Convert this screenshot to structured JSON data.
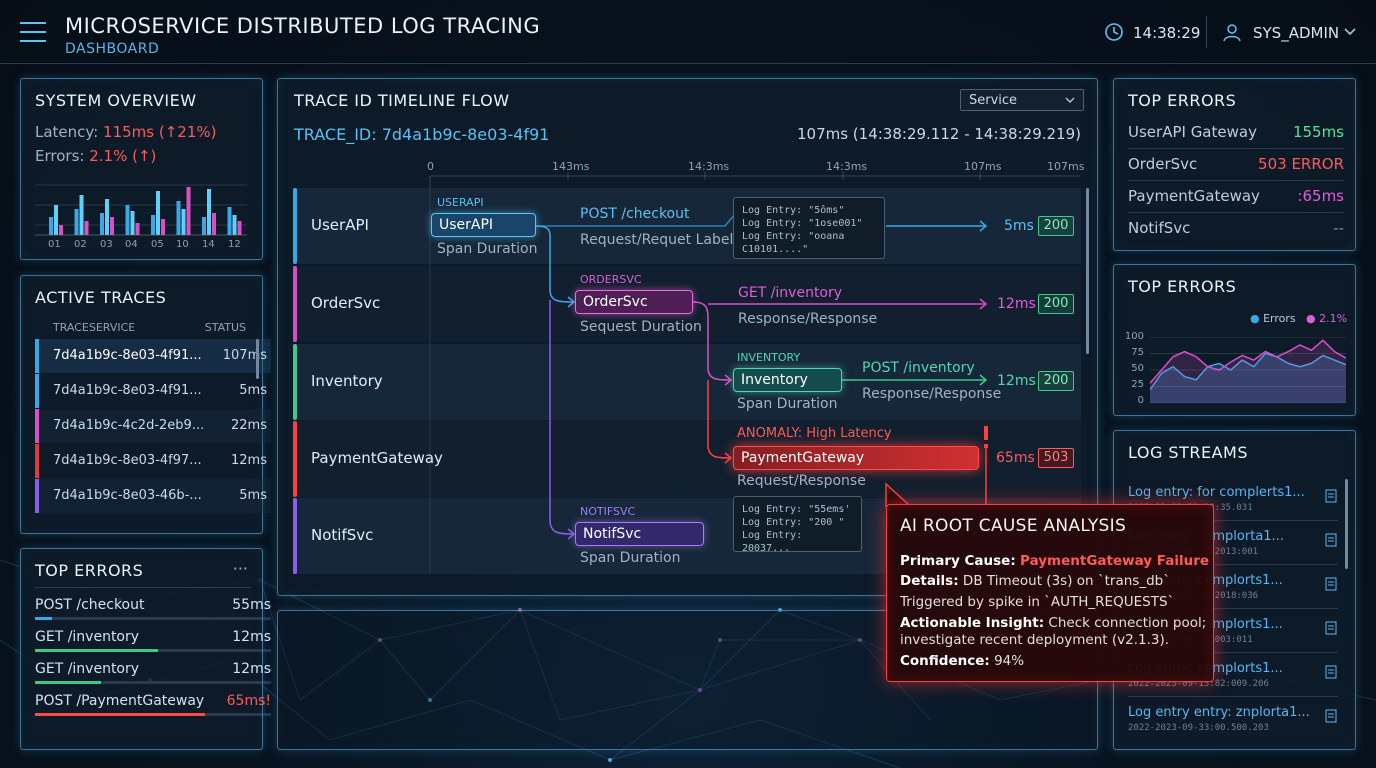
{
  "header": {
    "title": "MICROSERVICE DISTRIBUTED LOG TRACING",
    "subtitle": "DASHBOARD",
    "time": "14:38:29",
    "user": "SYS_ADMIN"
  },
  "system_overview": {
    "title": "SYSTEM OVERVIEW",
    "latency_label": "Latency:",
    "latency_value": "115ms (↑21%)",
    "errors_label": "Errors:",
    "errors_value": "2.1% (↑)",
    "chart_labels": [
      "01",
      "02",
      "03",
      "04",
      "05",
      "10",
      "14",
      "12"
    ]
  },
  "active_traces": {
    "title": "ACTIVE TRACES",
    "col_service": "TRACESERVICE",
    "col_status": "STATUS",
    "rows": [
      {
        "id": "7d4a1b9c-8e03-4f91...",
        "ms": "107ms",
        "color": "#3aa8e8"
      },
      {
        "id": "7d4a1b9c-8e03-4f91...",
        "ms": "5ms",
        "color": "#3aa8e8"
      },
      {
        "id": "7d4a1b9c-4c2d-2eb9...",
        "ms": "22ms",
        "color": "#d94fc8"
      },
      {
        "id": "7d4a1b9c-8e03-4f97...",
        "ms": "12ms",
        "color": "#e03a3a"
      },
      {
        "id": "7d4a1b9c-8e03-46b-...",
        "ms": "5ms",
        "color": "#8a5ee8"
      }
    ]
  },
  "top_errors_left": {
    "title": "TOP ERRORS",
    "menu": "···",
    "rows": [
      {
        "label": "POST /checkout",
        "ms": "55ms",
        "fill": 0.07,
        "color": "#3aa8e8"
      },
      {
        "label": "GET /inventory",
        "ms": "12ms",
        "fill": 0.52,
        "color": "#3fc98a"
      },
      {
        "label": "GET /inventory",
        "ms": "12ms",
        "fill": 0.28,
        "color": "#3fc98a"
      },
      {
        "label": "POST /PaymentGateway",
        "ms": "65ms!",
        "fill": 0.72,
        "color": "#ff4a4a"
      }
    ]
  },
  "timeline": {
    "title": "TRACE ID TIMELINE FLOW",
    "select_value": "Service",
    "trace_id": "TRACE_ID: 7d4a1b9c-8e03-4f91",
    "duration": "107ms (14:38:29.112 - 14:38:29.219)",
    "ticks": [
      "0",
      "143ms",
      "14:3ms",
      "14:3ms",
      "107ms",
      "107ms"
    ],
    "lanes": [
      "UserAPI",
      "OrderSvc",
      "Inventory",
      "PaymentGateway",
      "NotifSvc"
    ],
    "spans": {
      "userapi": {
        "tag": "USERAPI",
        "label": "UserAPI",
        "sub": "Span Duration",
        "call": "POST /checkout",
        "call_sub": "Request/Requet Label",
        "ms": "5ms",
        "status": "200"
      },
      "ordersvc": {
        "tag": "ORDERSVC",
        "label": "OrderSvc",
        "sub": "Sequest Duration",
        "call": "GET /inventory",
        "call_sub": "Response/Response",
        "ms": "12ms",
        "status": "200"
      },
      "inventory": {
        "tag": "INVENTORY",
        "label": "Inventory",
        "sub": "Span Duration",
        "call": "POST /inventory",
        "call_sub": "Response/Response",
        "ms": "12ms",
        "status": "200"
      },
      "payment": {
        "tag": "ANOMALY: High Latency",
        "label": "PaymentGateway",
        "sub": "Request/Response",
        "ms": "65ms",
        "status": "503"
      },
      "notif": {
        "tag": "NOTIFSVC",
        "label": "NotifSvc",
        "sub": "Span Duration"
      }
    },
    "log1": [
      "Log Entry: \"5ôms\"",
      "Log Entry: \"1ose001\"",
      "Log Entry: \"ooana C10101....\""
    ],
    "log2": [
      "Log Entry: \"55ems'",
      "Log Entry: \"200 \"",
      "Log Entry: 20037..."
    ]
  },
  "top_errors_right": {
    "title": "TOP ERRORS",
    "rows": [
      {
        "label": "UserAPI Gateway",
        "value": "155ms",
        "color": "#56e29b"
      },
      {
        "label": "OrderSvc",
        "value": "503 ERROR",
        "color": "#ff5a5a"
      },
      {
        "label": "PaymentGateway",
        "value": ":65ms",
        "color": "#e05cd8"
      },
      {
        "label": "NotifSvc",
        "value": "--",
        "color": "#8093a4"
      }
    ]
  },
  "top_errors_chart": {
    "title": "TOP ERRORS",
    "legend_errors": "Errors",
    "legend_pct": "2.1%"
  },
  "chart_data": {
    "type": "area",
    "title": "TOP ERRORS",
    "y_ticks": [
      "100",
      "75",
      "50",
      "25",
      "0"
    ],
    "ylim": [
      0,
      100
    ],
    "series": [
      {
        "name": "Errors",
        "values": [
          20,
          45,
          55,
          40,
          35,
          55,
          60,
          50,
          65,
          55,
          75,
          70,
          60,
          55,
          60,
          72,
          65,
          58
        ],
        "color": "#3aa8e8"
      },
      {
        "name": "2.1%",
        "values": [
          30,
          50,
          70,
          78,
          70,
          55,
          50,
          62,
          72,
          65,
          78,
          70,
          78,
          88,
          80,
          95,
          78,
          68
        ],
        "color": "#d94fc8"
      }
    ]
  },
  "log_streams": {
    "title": "LOG STREAMS",
    "rows": [
      {
        "a": "Log entry: for complerts1...",
        "b": "2022-23-11 12:33:35.031"
      },
      {
        "a": "Log entry: complorta1...",
        "b": "2022-2023-09-33:2013:001"
      },
      {
        "a": "Log entry: complorts1...",
        "b": "2022-2023-09-33:2018:036"
      },
      {
        "a": "Log entry: complorts1...",
        "b": "2022-2023-09-33:003:011"
      },
      {
        "a": "Log entry: complorts1...",
        "b": "2022-2023-09-13:82:009.206"
      },
      {
        "a": "Log entry entry: znplorta1...",
        "b": "2022-2023-09-33:00.500.203"
      }
    ]
  },
  "ai": {
    "title": "AI ROOT CAUSE ANALYSIS",
    "primary_label": "Primary Cause:",
    "primary_value": "PaymentGateway Failure",
    "details_label": "Details:",
    "details_value": "DB Timeout (3s) on `trans_db`",
    "trigger": "Triggered by spike in `AUTH_REQUESTS`",
    "insight_label": "Actionable Insight:",
    "insight_value": "Check connection pool;",
    "insight_value2": "investigate recent deployment (v2.1.3).",
    "confidence_label": "Confidence:",
    "confidence_value": "94%"
  }
}
